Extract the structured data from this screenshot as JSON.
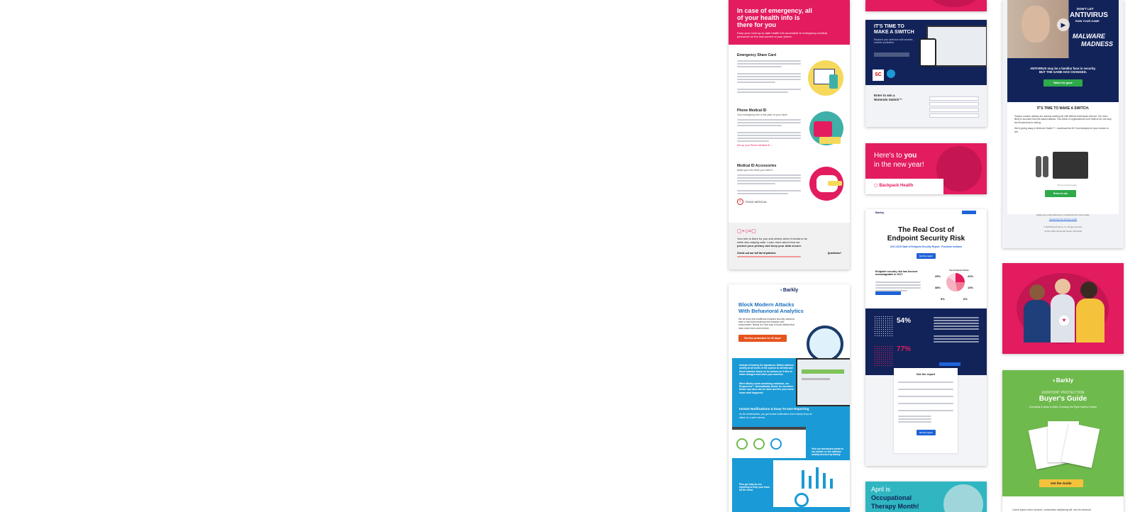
{
  "emergency": {
    "hero_title": "In case of emergency, all of your health info is there for you",
    "hero_sub": "Keep your most up-to-date health info accessible to emergency medical personnel on the lock screen of your phone.",
    "sections": [
      {
        "title": "Emergency Share Card"
      },
      {
        "title": "Phone Medical ID",
        "sub": "Your emergency info in the palm of your hand"
      },
      {
        "title": "Medical ID Accessories",
        "sub": "Make your info there you need it"
      }
    ],
    "link_text": "Set up your Phone Medical ID →",
    "partner": "ROAD MEDICAL",
    "footer_line1": "Your info is there for you and others when it needs to be",
    "footer_line2": "while also staying safe. Learn more about how we",
    "footer_line3": "protect your privacy and keep your data secure.",
    "footer_policies": "Check out our full list of policies:",
    "footer_questions": "Questions?"
  },
  "switch": {
    "headline1": "IT'S TIME TO",
    "headline2": "MAKE A SWITCH",
    "sub": "Replace your antivirus with smarter, smarter protection.",
    "sc_label": "SC",
    "enter1": "Enter to win a",
    "enter2": "Nintendo Switch™"
  },
  "newyear": {
    "line1": "Here's to ",
    "line1_bold": "you",
    "line2": "in the new year!",
    "brand": "Backpack Health"
  },
  "realcost": {
    "brand": "Barkly",
    "title1": "The Real Cost of",
    "title2": "Endpoint Security Risk",
    "subtitle": "2017-2018 State of Endpoint Security Report - Ponemon Institute",
    "btn": "Get the report",
    "body_title": "Endpoint security risk has become unmanageable in 2017.",
    "chart_title": "Top Endpoint Risks",
    "stats": [
      "25%",
      "22%",
      "38%",
      "13%",
      "9%",
      "6%"
    ],
    "big_stat1": "54%",
    "big_stat2": "77%",
    "form_title": "Get the report",
    "form_btn": "Get the report"
  },
  "otmonth": {
    "line1": "April is",
    "line2": "Occupational",
    "line3": "Therapy Month!"
  },
  "antivirus": {
    "dont_let": "DON'T LET",
    "big": "ANTIVIRUS",
    "ruin": "RUIN YOUR GAME",
    "malware1": "MALWARE",
    "malware2": "MADNESS",
    "claim1": "ANTIVIRUS may be a familiar face in security.",
    "claim2": "BUT THE GAME HAS CHANGED.",
    "watch_btn": "Watch the game",
    "switch_title": "IT'S TIME TO MAKE A SWITCH.",
    "body1": "Today's modern attacks are actively evading AV with fileless techniques that are 10X more likely to succeed than file-based attacks. Two-thirds of organizations don't believe AV can stop the threats they're seeing.",
    "body2": "We're giving away a Nintendo Switch™ - download the AV Cost Analysis for your chance to win.",
    "enter_btn": "Enter to win",
    "fine_print": "*Some restrictions apply",
    "footer1": "Update your email preferences or unsubscribe from future emails.",
    "footer2": "Unsubscribe from all future emails",
    "footer3": "© 2018 Barkly Protects, Inc. All rights reserved.",
    "footer4": "10 Post Office Sq Ste 300, Boston, MA 02109"
  },
  "behavioral": {
    "brand": "Barkly",
    "title1": "Block Modern Attacks",
    "title2": "With Behavioral Analytics",
    "intro": "We all know that traditional endpoint security solutions have a hard time blocking new malware and ransomware. Barkly is a new way to block attacks that have never been seen before.",
    "btn": "Get free protection for 30 days!",
    "p1": "Instead of looking for signatures, Barkly watches activity at all levels of the system to identify and block malware based on its actions as it tries to make changes and infect your machine.",
    "p2": "When Barkly spots something malicious, our Responsive™ automatically blocks its execution before any harm can be done and lets your users know what happened.",
    "section2": "Instant Notifications & Easy-To-Use Reporting",
    "p3": "As the administrator, you get instant notifications when Barkly stops an attack on a user's device.",
    "callout1": "Visit our dashboard portal to see details on the malware activity blocked by Barkly.",
    "callout2": "Plus get easy-to-use reporting to help your team hit the trend."
  },
  "buyers": {
    "brand": "Barkly",
    "kicker": "ENDPOINT PROTECTION",
    "title": "Buyer's Guide",
    "sub": "Checklists & Ideas to Make Choosing the Right Solution Simple",
    "btn": "Get the Guide",
    "lorem": "Lorem ipsum dolor sit amet, consectetur adipiscing elit, sed do eiusmod"
  },
  "colors": {
    "pink": "#e31c5f",
    "navy": "#12235a",
    "blue": "#1a9ad6",
    "green": "#6fba4d",
    "orange": "#e5541e",
    "button_blue": "#1f63d8",
    "button_green": "#2eaa4b",
    "yellow": "#f5c33b"
  }
}
